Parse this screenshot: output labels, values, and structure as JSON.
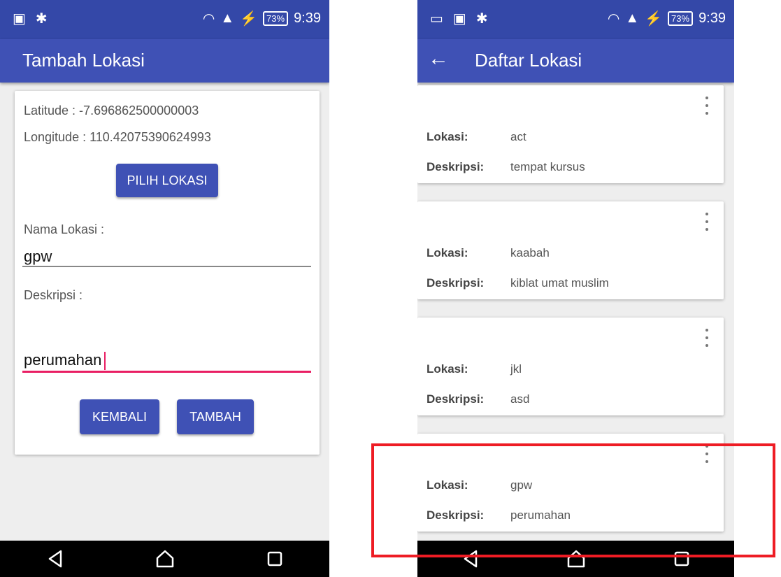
{
  "colors": {
    "primary": "#3f51b5",
    "primary_dark": "#3448a8",
    "accent": "#e91e63",
    "highlight": "#ee1c24"
  },
  "left_screen": {
    "status": {
      "battery": "73%",
      "time": "9:39"
    },
    "title": "Tambah Lokasi",
    "latitude_text": "Latitude : -7.696862500000003",
    "longitude_text": "Longitude : 110.42075390624993",
    "pick_button": "PILIH LOKASI",
    "name_label": "Nama Lokasi :",
    "name_value": "gpw",
    "desc_label": "Deskripsi :",
    "desc_value": "perumahan",
    "back_button": "KEMBALI",
    "add_button": "TAMBAH"
  },
  "right_screen": {
    "status": {
      "battery": "73%",
      "time": "9:39"
    },
    "title": "Daftar Lokasi",
    "back_icon": "arrow-left-icon",
    "lokasi_label": "Lokasi:",
    "deskripsi_label": "Deskripsi:",
    "items": [
      {
        "lokasi": "act",
        "deskripsi": "tempat kursus"
      },
      {
        "lokasi": "kaabah",
        "deskripsi": "kiblat umat muslim"
      },
      {
        "lokasi": "jkl",
        "deskripsi": "asd"
      },
      {
        "lokasi": "gpw",
        "deskripsi": "perumahan"
      }
    ]
  }
}
